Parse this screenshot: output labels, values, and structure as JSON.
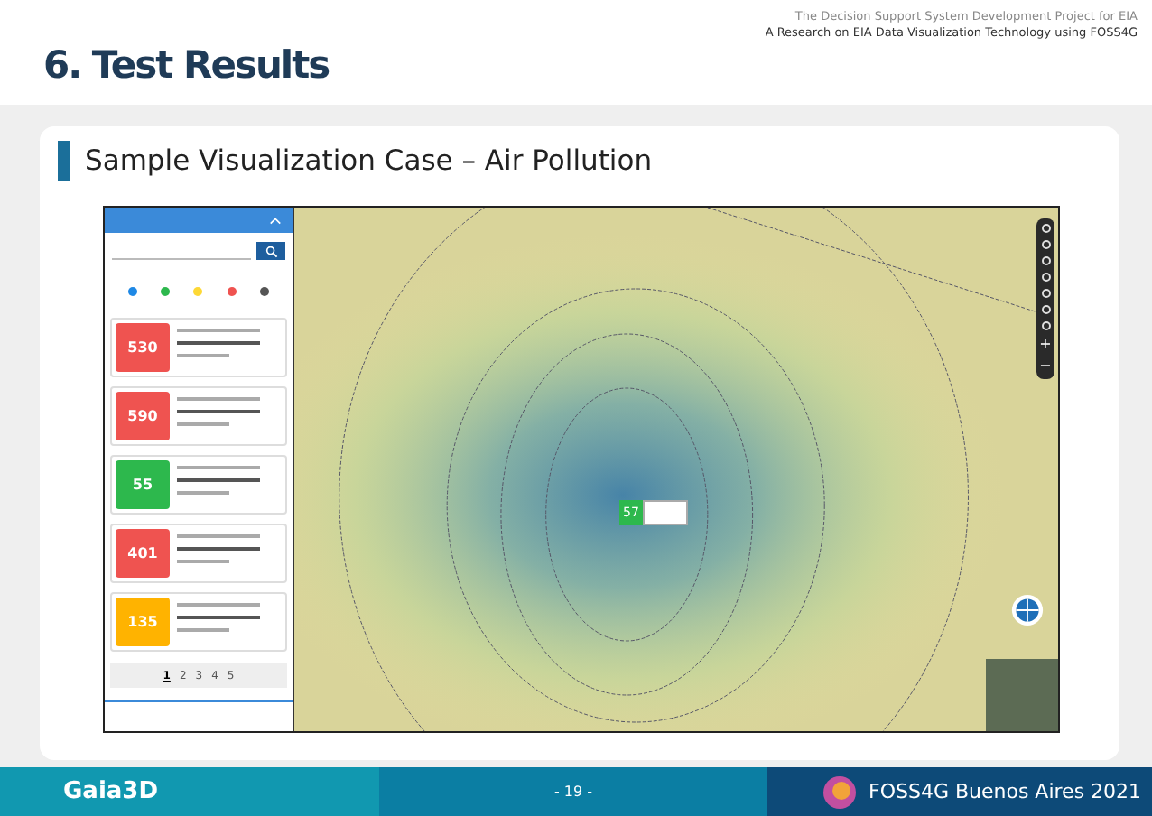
{
  "header": {
    "title": "6. Test Results",
    "project": "The Decision Support System Development Project for EIA",
    "subtitle": "A Research on EIA Data Visualization Technology using FOSS4G"
  },
  "section": {
    "title": "Sample Visualization Case – Air Pollution"
  },
  "screenshot": {
    "legend": [
      {
        "color": "#1e88e5"
      },
      {
        "color": "#2db84d"
      },
      {
        "color": "#fdd835"
      },
      {
        "color": "#ef5350"
      },
      {
        "color": "#555555"
      }
    ],
    "cards": [
      {
        "value": "530",
        "color": "#ef5350"
      },
      {
        "value": "590",
        "color": "#ef5350"
      },
      {
        "value": "55",
        "color": "#2db84d"
      },
      {
        "value": "401",
        "color": "#ef5350"
      },
      {
        "value": "135",
        "color": "#ffb300"
      }
    ],
    "pages": [
      {
        "label": "1",
        "selected": true
      },
      {
        "label": "2",
        "selected": false
      },
      {
        "label": "3",
        "selected": false
      },
      {
        "label": "4",
        "selected": false
      },
      {
        "label": "5",
        "selected": false
      }
    ],
    "zoom_in": "+",
    "zoom_out": "−",
    "marker": {
      "value": "57",
      "color": "#2db84d"
    }
  },
  "footer": {
    "logo": "Gaia3D",
    "page": "- 19 -",
    "event": "FOSS4G Buenos Aires 2021"
  }
}
